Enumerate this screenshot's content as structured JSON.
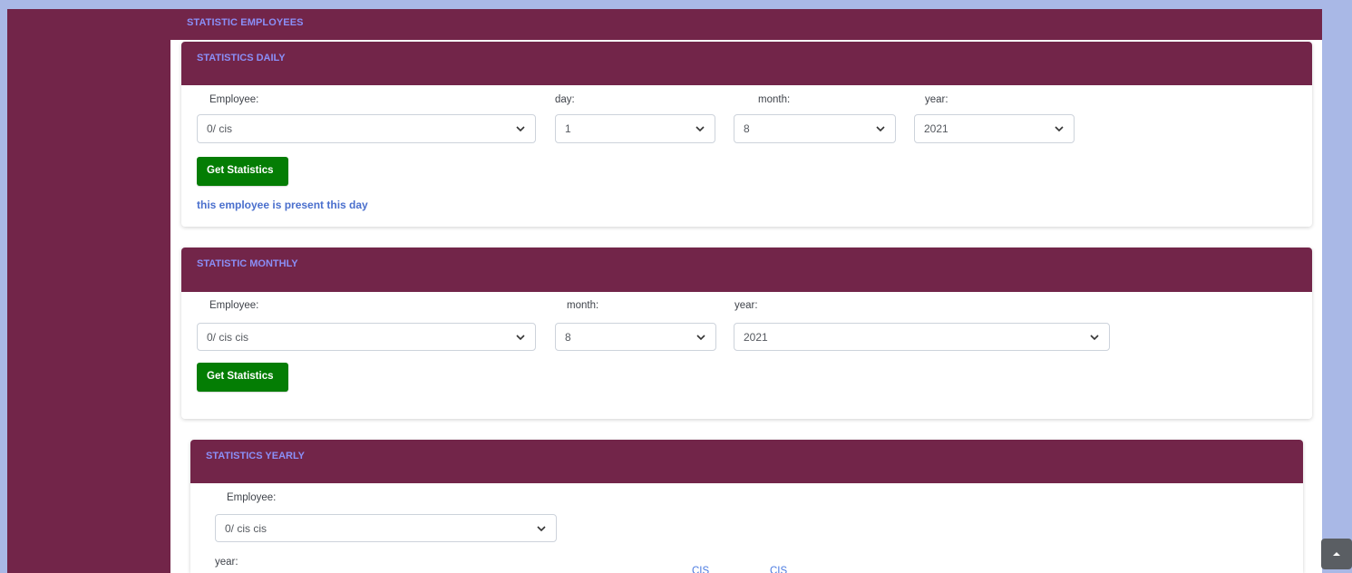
{
  "page_header": "STATISTIC EMPLOYEES",
  "daily": {
    "title": "STATISTICS DAILY",
    "employee_label": "Employee:",
    "employee_value": "0/ cis",
    "day_label": "day:",
    "day_value": "1",
    "month_label": "month:",
    "month_value": "8",
    "year_label": "year:",
    "year_value": "2021",
    "button": "Get Statistics",
    "message": "this employee is present this day"
  },
  "monthly": {
    "title": "STATISTIC MONTHLY",
    "employee_label": "Employee:",
    "employee_value": "0/ cis cis",
    "month_label": "month:",
    "month_value": "8",
    "year_label": "year:",
    "year_value": "2021",
    "button": "Get Statistics"
  },
  "yearly": {
    "title": "STATISTICS YEARLY",
    "employee_label": "Employee:",
    "employee_value": "0/ cis cis",
    "year_label": "year:",
    "links": [
      "CIS",
      "CIS"
    ]
  },
  "icons": {
    "select_arrow": "chevron-down-icon",
    "scroll_top": "chevron-up-icon"
  },
  "colors": {
    "brand": "#722549",
    "header_text": "#8a8ff7",
    "button": "#047d04",
    "right_bg": "#a9b8e6",
    "message": "#4a6fcd"
  }
}
